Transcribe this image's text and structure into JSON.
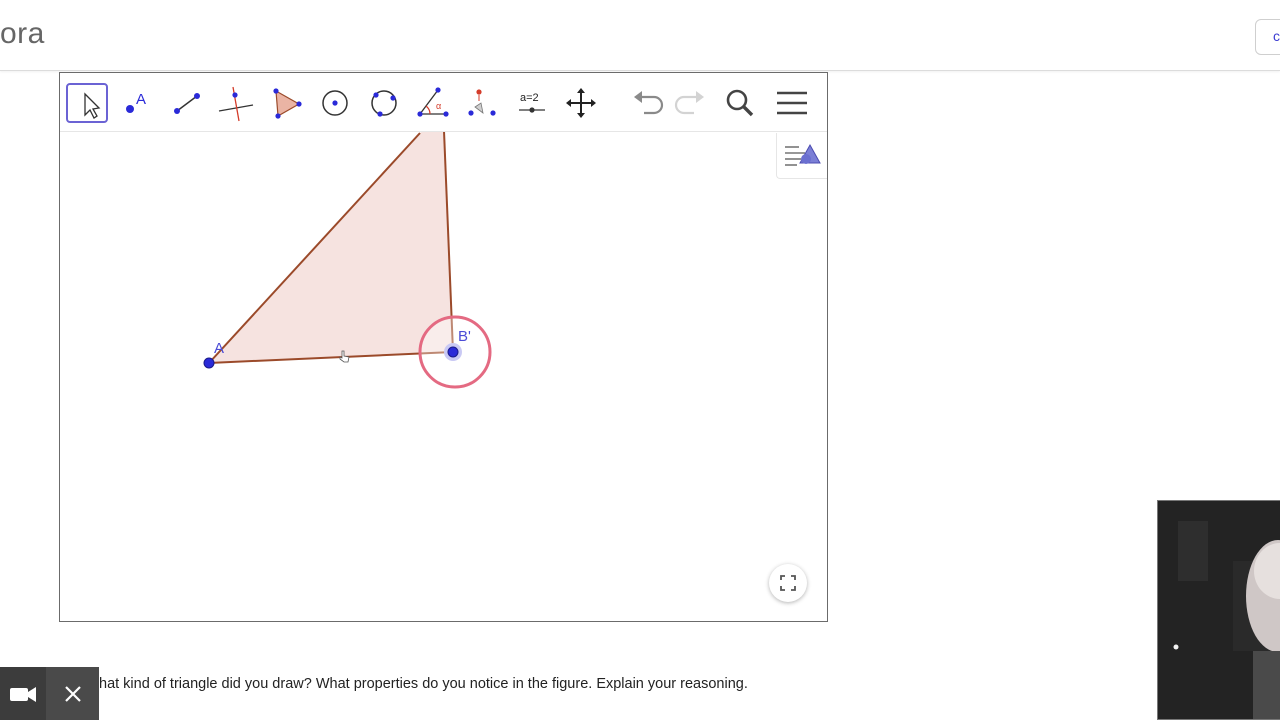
{
  "header": {
    "brand_text": "ora",
    "corner_button_label": "c"
  },
  "toolbar": {
    "tools": [
      {
        "name": "move-tool",
        "icon": "arrow-pointer-icon",
        "active": true
      },
      {
        "name": "point-tool",
        "icon": "point-icon",
        "label": "A"
      },
      {
        "name": "segment-tool",
        "icon": "segment-icon"
      },
      {
        "name": "perpendicular-line-tool",
        "icon": "perpendicular-line-icon"
      },
      {
        "name": "polygon-tool",
        "icon": "polygon-icon"
      },
      {
        "name": "circle-tool",
        "icon": "circle-center-point-icon"
      },
      {
        "name": "circle-three-points-tool",
        "icon": "circle-three-points-icon"
      },
      {
        "name": "angle-tool",
        "icon": "angle-icon"
      },
      {
        "name": "reflect-tool",
        "icon": "reflect-point-icon"
      },
      {
        "name": "slider-tool",
        "icon": "slider-icon",
        "label": "a=2"
      },
      {
        "name": "move-graphics-tool",
        "icon": "move-arrows-icon"
      }
    ],
    "undo_icon": "undo-icon",
    "redo_icon": "redo-icon",
    "search_icon": "search-icon",
    "menu_icon": "hamburger-menu-icon"
  },
  "construction": {
    "point_a_label": "A",
    "point_b_label": "B'",
    "fill_color": "#f6e3e0",
    "edge_color": "#9b4a2a",
    "point_color": "#2a2ad8",
    "label_color": "#4b4bd6",
    "highlight_color": "#e46a82"
  },
  "question_text": "hat kind of triangle did you draw?  What properties do you notice in the figure.  Explain your reasoning.",
  "video_controls": {
    "camera_icon": "video-camera-icon",
    "close_icon": "close-icon"
  }
}
